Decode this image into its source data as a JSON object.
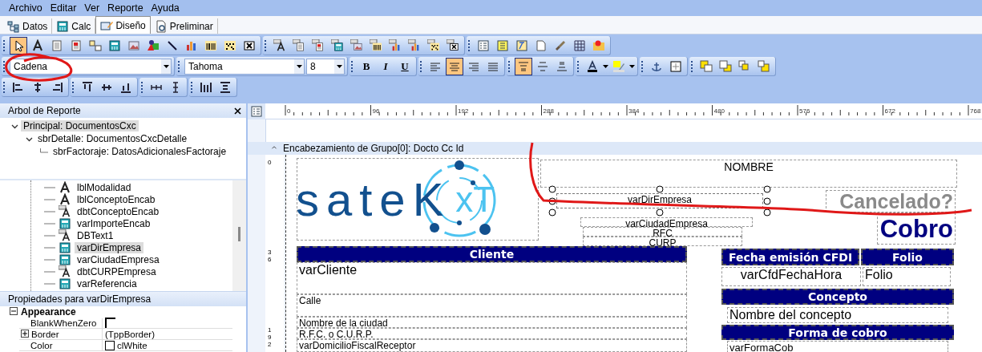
{
  "menu": [
    {
      "label": "Archivo"
    },
    {
      "label": "Editar"
    },
    {
      "label": "Ver"
    },
    {
      "label": "Reporte"
    },
    {
      "label": "Ayuda"
    }
  ],
  "view_tabs": [
    {
      "kind": "data",
      "label": "Datos",
      "selected": false
    },
    {
      "kind": "calc",
      "label": "Calc",
      "selected": false
    },
    {
      "kind": "design",
      "label": "Diseño",
      "selected": true
    },
    {
      "kind": "preview",
      "label": "Preliminar",
      "selected": false
    }
  ],
  "toolbar_rows": [
    {
      "groups": [
        {
          "buttons": [
            {
              "kind": "pointer",
              "selected": true
            },
            {
              "kind": "text",
              "selected": false
            },
            {
              "kind": "memo",
              "selected": false
            },
            {
              "kind": "rich",
              "selected": false
            },
            {
              "kind": "check",
              "selected": false
            },
            {
              "kind": "calc",
              "selected": false
            },
            {
              "kind": "image",
              "selected": false
            },
            {
              "kind": "shape",
              "selected": false
            },
            {
              "kind": "line",
              "selected": false
            },
            {
              "kind": "chart",
              "selected": false
            },
            {
              "kind": "barcode",
              "selected": false
            },
            {
              "kind": "matrix",
              "selected": false
            },
            {
              "kind": "box",
              "selected": false
            }
          ]
        },
        {
          "buttons": [
            {
              "kind": "db-text",
              "selected": false
            },
            {
              "kind": "db-memo",
              "selected": false
            },
            {
              "kind": "db-rich",
              "selected": false
            },
            {
              "kind": "db-calc",
              "selected": false
            },
            {
              "kind": "db-image",
              "selected": false
            },
            {
              "kind": "db-barcode",
              "selected": false
            },
            {
              "kind": "db-chart",
              "selected": false
            },
            {
              "kind": "db-chart",
              "selected": false
            },
            {
              "kind": "db-matrix",
              "selected": false
            },
            {
              "kind": "db-box",
              "selected": false
            }
          ]
        },
        {
          "buttons": [
            {
              "kind": "region",
              "selected": false
            },
            {
              "kind": "subreport",
              "selected": false
            },
            {
              "kind": "crosstab",
              "selected": false
            },
            {
              "kind": "page",
              "selected": false
            },
            {
              "kind": "brush",
              "selected": false
            },
            {
              "kind": "grid",
              "selected": false
            },
            {
              "kind": "map",
              "selected": false
            }
          ]
        }
      ]
    },
    {
      "groups": [
        {
          "buttons": [
            {
              "kind": "combo",
              "value": "Cadena"
            }
          ]
        },
        {
          "buttons": [
            {
              "kind": "combo",
              "value": "Tahoma"
            },
            {
              "kind": "combo",
              "value": "8"
            }
          ]
        },
        {
          "buttons": [
            {
              "kind": "bold",
              "label": "B",
              "selected": false
            },
            {
              "kind": "italic",
              "label": "I",
              "selected": false
            },
            {
              "kind": "underline",
              "label": "U",
              "selected": false
            }
          ]
        },
        {
          "buttons": [
            {
              "kind": "align-left",
              "selected": false
            },
            {
              "kind": "align-center",
              "selected": true
            },
            {
              "kind": "align-right",
              "selected": false
            },
            {
              "kind": "justify",
              "selected": false
            }
          ]
        },
        {
          "buttons": [
            {
              "kind": "valign-top",
              "selected": true
            },
            {
              "kind": "valign-middle",
              "selected": false
            },
            {
              "kind": "valign-bottom",
              "selected": false
            }
          ]
        },
        {
          "buttons": [
            {
              "kind": "font-color",
              "selected": false
            },
            {
              "kind": "highlight",
              "selected": false
            }
          ]
        },
        {
          "buttons": [
            {
              "kind": "anchor",
              "selected": false
            },
            {
              "kind": "border",
              "selected": false
            }
          ]
        },
        {
          "buttons": [
            {
              "kind": "front",
              "selected": false
            },
            {
              "kind": "back",
              "selected": false
            },
            {
              "kind": "forward",
              "selected": false
            },
            {
              "kind": "backward",
              "selected": false
            }
          ]
        }
      ]
    },
    {
      "groups": [
        {
          "buttons": [
            {
              "kind": "left-edges",
              "selected": false
            },
            {
              "kind": "h-centers",
              "selected": false
            },
            {
              "kind": "right-edges",
              "selected": false
            }
          ]
        },
        {
          "buttons": [
            {
              "kind": "top-edges",
              "selected": false
            },
            {
              "kind": "v-centers",
              "selected": false
            },
            {
              "kind": "bottom-edges",
              "selected": false
            }
          ]
        },
        {
          "buttons": [
            {
              "kind": "h-spacing",
              "selected": false
            },
            {
              "kind": "v-spacing",
              "selected": false
            }
          ]
        },
        {
          "buttons": [
            {
              "kind": "same-height",
              "selected": false
            },
            {
              "kind": "same-width",
              "selected": false
            }
          ]
        }
      ]
    }
  ],
  "report_tree": {
    "title": "Arbol de Reporte",
    "items": [
      {
        "label": "Principal: DocumentosCxc",
        "expanded": true,
        "selected": true,
        "children": [
          {
            "label": "sbrDetalle: DocumentosCxcDetalle",
            "expanded": true,
            "selected": false,
            "children": [
              {
                "label": "sbrFactoraje: DatosAdicionalesFactoraje",
                "selected": false
              }
            ]
          }
        ]
      }
    ]
  },
  "components": [
    {
      "kind": "label",
      "label": "lblModalidad",
      "selected": false
    },
    {
      "kind": "label",
      "label": "lblConceptoEncab",
      "selected": false
    },
    {
      "kind": "db-text",
      "label": "dbtConceptoEncab",
      "selected": false
    },
    {
      "kind": "variable",
      "label": "varImporteEncab",
      "selected": false
    },
    {
      "kind": "db-text",
      "label": "DBText1",
      "selected": false
    },
    {
      "kind": "variable",
      "label": "varDirEmpresa",
      "selected": true
    },
    {
      "kind": "variable",
      "label": "varCiudadEmpresa",
      "selected": false
    },
    {
      "kind": "db-text",
      "label": "dbtCURPEmpresa",
      "selected": false
    },
    {
      "kind": "variable",
      "label": "varReferencia",
      "selected": false
    }
  ],
  "properties": {
    "title": "Propiedades para varDirEmpresa",
    "category": "Appearance",
    "expanded": true,
    "rows": [
      {
        "kind": "checkbox",
        "name": "BlankWhenZero",
        "checked": false
      },
      {
        "kind": "object",
        "name": "Border",
        "value": "(TppBorder)",
        "expanded": false
      },
      {
        "kind": "color",
        "name": "Color",
        "value": "clWhite",
        "color": "#ffffff"
      }
    ]
  },
  "designer": {
    "ruler_labels": [
      "0",
      "96",
      "192",
      "288",
      "384",
      "480",
      "576",
      "672",
      "768"
    ],
    "vertical_ruler_labels": [
      "0",
      "36",
      "192"
    ],
    "band": {
      "title": "Encabezamiento de Grupo[0]: Docto Cc Id",
      "expanded": true
    },
    "report_items": [
      {
        "kind": "logo",
        "text": "sateK",
        "accent": "xT"
      },
      {
        "kind": "text",
        "text": "NOMBRE",
        "selected": false
      },
      {
        "kind": "text",
        "text": "varDirEmpresa",
        "selected": true
      },
      {
        "kind": "title",
        "text": "Cancelado?",
        "selected": false
      },
      {
        "kind": "text",
        "text": "varCiudadEmpresa",
        "selected": false
      },
      {
        "kind": "text",
        "text": "RFC",
        "selected": false
      },
      {
        "kind": "text",
        "text": "CURP",
        "selected": false
      },
      {
        "kind": "title",
        "text": "Cobro",
        "selected": false
      },
      {
        "kind": "header",
        "text": "Cliente",
        "selected": false
      },
      {
        "kind": "text",
        "text": "varCliente",
        "selected": false
      },
      {
        "kind": "text",
        "text": "Calle",
        "selected": false
      },
      {
        "kind": "text",
        "text": "Nombre de la ciudad",
        "selected": false
      },
      {
        "kind": "text",
        "text": "R.F.C. o C.U.R.P.",
        "selected": false
      },
      {
        "kind": "text",
        "text": "varDomicilioFiscalReceptor",
        "selected": false
      },
      {
        "kind": "header",
        "text": "Fecha emisión CFDI",
        "selected": false
      },
      {
        "kind": "header",
        "text": "Folio",
        "selected": false
      },
      {
        "kind": "text",
        "text": "varCfdFechaHora",
        "selected": false
      },
      {
        "kind": "text",
        "text": "Folio",
        "selected": false
      },
      {
        "kind": "header",
        "text": "Concepto",
        "selected": false
      },
      {
        "kind": "text",
        "text": "Nombre del concepto",
        "selected": false
      },
      {
        "kind": "header",
        "text": "Forma de cobro",
        "selected": false
      },
      {
        "kind": "text",
        "text": "varFormaCob",
        "selected": false
      }
    ]
  }
}
